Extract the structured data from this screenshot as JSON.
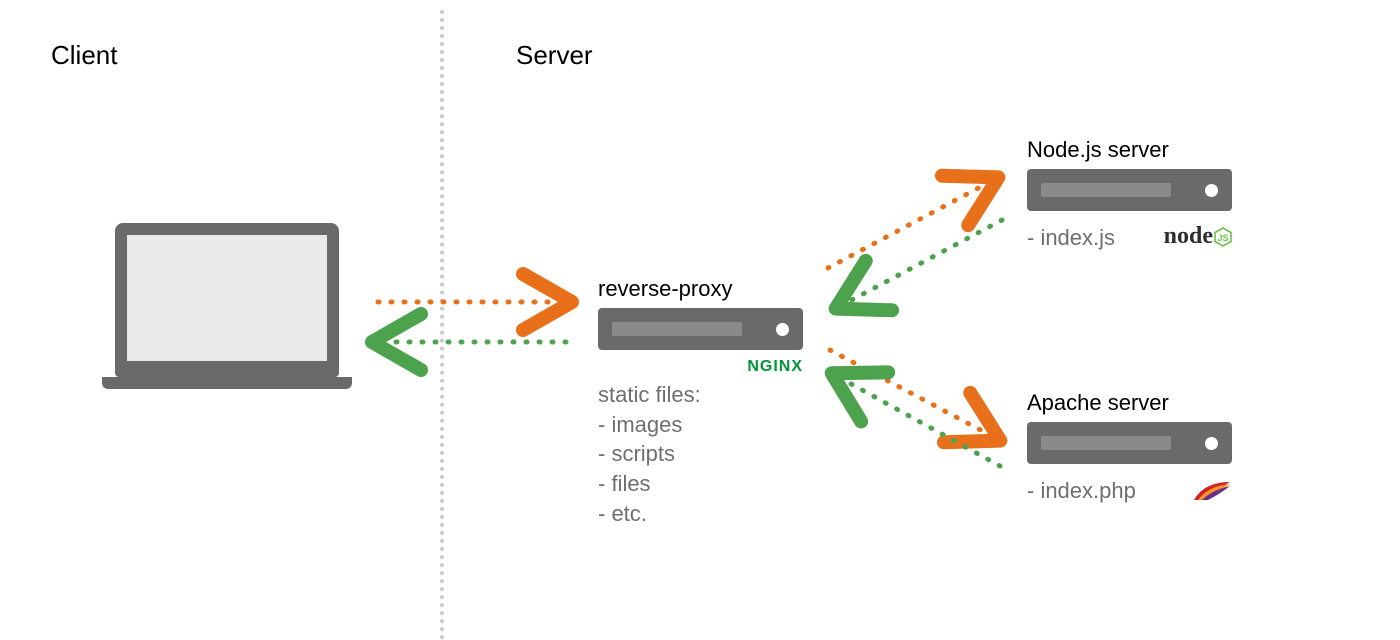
{
  "sections": {
    "client_title": "Client",
    "server_title": "Server"
  },
  "proxy": {
    "title": "reverse-proxy",
    "logo_text": "NGINX",
    "static_heading": "static files:",
    "static_items": [
      "- images",
      "- scripts",
      "- files",
      "- etc."
    ]
  },
  "backends": {
    "node": {
      "title": "Node.js server",
      "file": "- index.js",
      "logo_word": "node"
    },
    "apache": {
      "title": "Apache server",
      "file": "- index.php"
    }
  },
  "colors": {
    "request": "#e8701a",
    "response": "#4da24d",
    "metal": "#6a6a6a"
  }
}
